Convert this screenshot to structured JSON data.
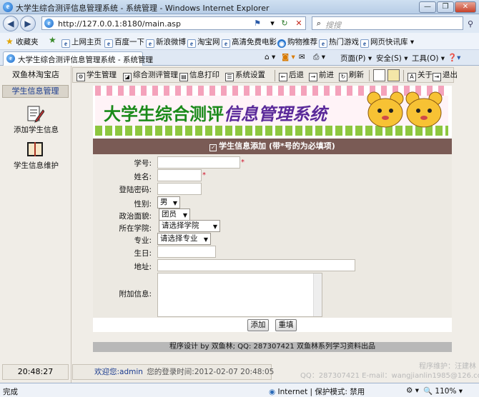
{
  "window": {
    "title": "大学生综合测评信息管理系统 - 系统管理 - Windows Internet Explorer",
    "controls": [
      "minimize-icon",
      "restore-icon",
      "close-icon"
    ]
  },
  "address_bar": {
    "url": "http://127.0.0.1:8180/main.asp",
    "search_placeholder": "搜搜"
  },
  "favorites_bar": {
    "favorites_label": "收藏夹",
    "items": [
      "上网主页",
      "百度一下",
      "新浪微博",
      "淘宝网",
      "高清免费电影",
      "购物推荐",
      "热门游戏",
      "网页快讯库"
    ]
  },
  "tab_bar": {
    "tab_title": "大学生综合测评信息管理系统 - 系统管理",
    "tools": {
      "page": "页面(P)",
      "safety": "安全(S)",
      "tools": "工具(O)"
    }
  },
  "sidebar": {
    "shop_name": "双鱼林淘宝店",
    "menu_header": "学生信息管理",
    "items": [
      {
        "label": "添加学生信息",
        "icon": "edit-document-icon"
      },
      {
        "label": "学生信息维护",
        "icon": "book-icon"
      }
    ]
  },
  "toolbar": {
    "student_mgmt": "学生管理",
    "eval_mgmt": "综合测评管理",
    "print": "信息打印",
    "settings": "系统设置",
    "back": "后退",
    "forward": "前进",
    "refresh": "刷新",
    "about": "关于",
    "exit": "退出"
  },
  "banner": {
    "title_part1": "大学生综合测评",
    "title_part2": "信息管理系统"
  },
  "form": {
    "title": "学生信息添加 (带*号的为必填项)",
    "fields": {
      "student_no": "学号:",
      "name": "姓名:",
      "password": "登陆密码:",
      "gender": "性别:",
      "political": "政治面貌:",
      "college": "所在学院:",
      "major": "专业:",
      "birthday": "生日:",
      "address": "地址:",
      "notes": "附加信息:"
    },
    "values": {
      "gender": "男",
      "political": "团员",
      "college": "请选择学院",
      "major": "请选择专业"
    },
    "required_mark": "*",
    "buttons": {
      "add": "添加",
      "reset": "重填"
    }
  },
  "footer": {
    "design": "程序设计 by 双鱼林; QQ: 287307421 双鱼林系列学习资料出品"
  },
  "status": {
    "time": "20:48:27",
    "welcome": "欢迎您:admin",
    "login_time": "您的登录时间:2012-02-07 20:48:05",
    "maintainer": "程序维护：汪建林",
    "contact": "QQ：287307421 E-mail：wangjianlin1985@126.com"
  },
  "ie_status": {
    "left": "完成",
    "zone": "Internet | 保护模式: 禁用",
    "zoom": "110%"
  },
  "colors": {
    "form_title_bg": "#7a5b55",
    "required": "#d0102a",
    "link_blue": "#1a3b8f"
  }
}
